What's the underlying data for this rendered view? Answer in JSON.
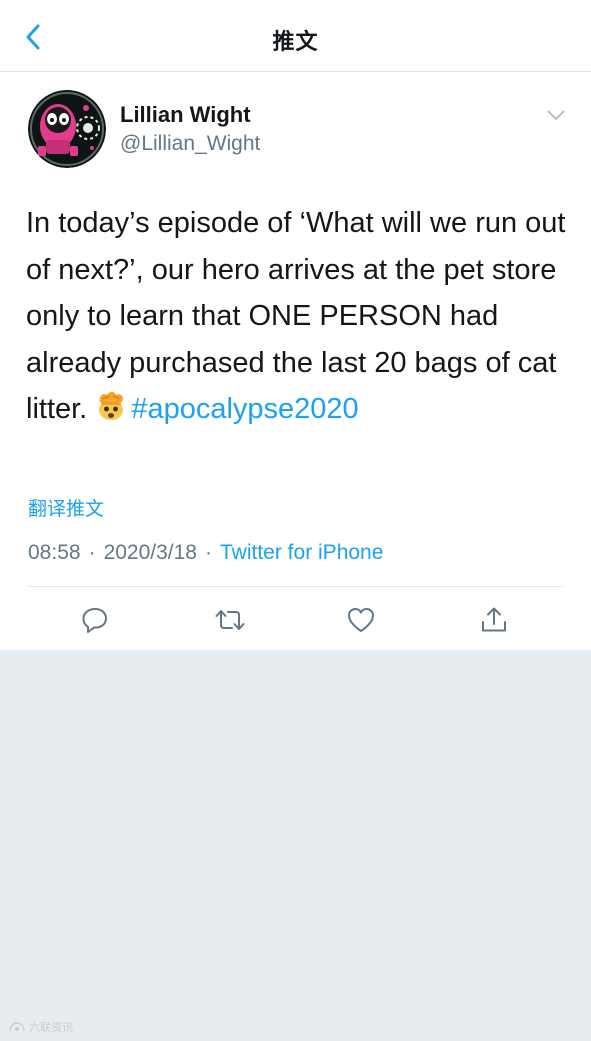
{
  "header": {
    "title": "推文",
    "back_icon": "chevron-left-icon"
  },
  "tweet": {
    "display_name": "Lillian Wight",
    "handle": "@Lillian_Wight",
    "text": "In today’s episode of ‘What will we run out of next?’, our hero arrives at the pet store only to learn that ONE PERSON had already purchased the last 20 bags of cat litter. ",
    "emoji": "exploding-head-emoji",
    "hashtag": "#apocalypse2020",
    "translate_label": "翻译推文",
    "time": "08:58",
    "date": "2020/3/18",
    "separator": "·",
    "source": "Twitter for iPhone"
  },
  "actions": [
    {
      "name": "reply",
      "icon": "reply-icon"
    },
    {
      "name": "retweet",
      "icon": "retweet-icon"
    },
    {
      "name": "like",
      "icon": "heart-icon"
    },
    {
      "name": "share",
      "icon": "share-icon"
    }
  ],
  "watermark": {
    "text": "六联资讯"
  },
  "colors": {
    "accent": "#1da1f2",
    "text_primary": "#14171a",
    "text_secondary": "#657786",
    "background": "#e6ecf0",
    "avatar_bg": "#0d1414",
    "avatar_pink": "#e23c8f"
  }
}
